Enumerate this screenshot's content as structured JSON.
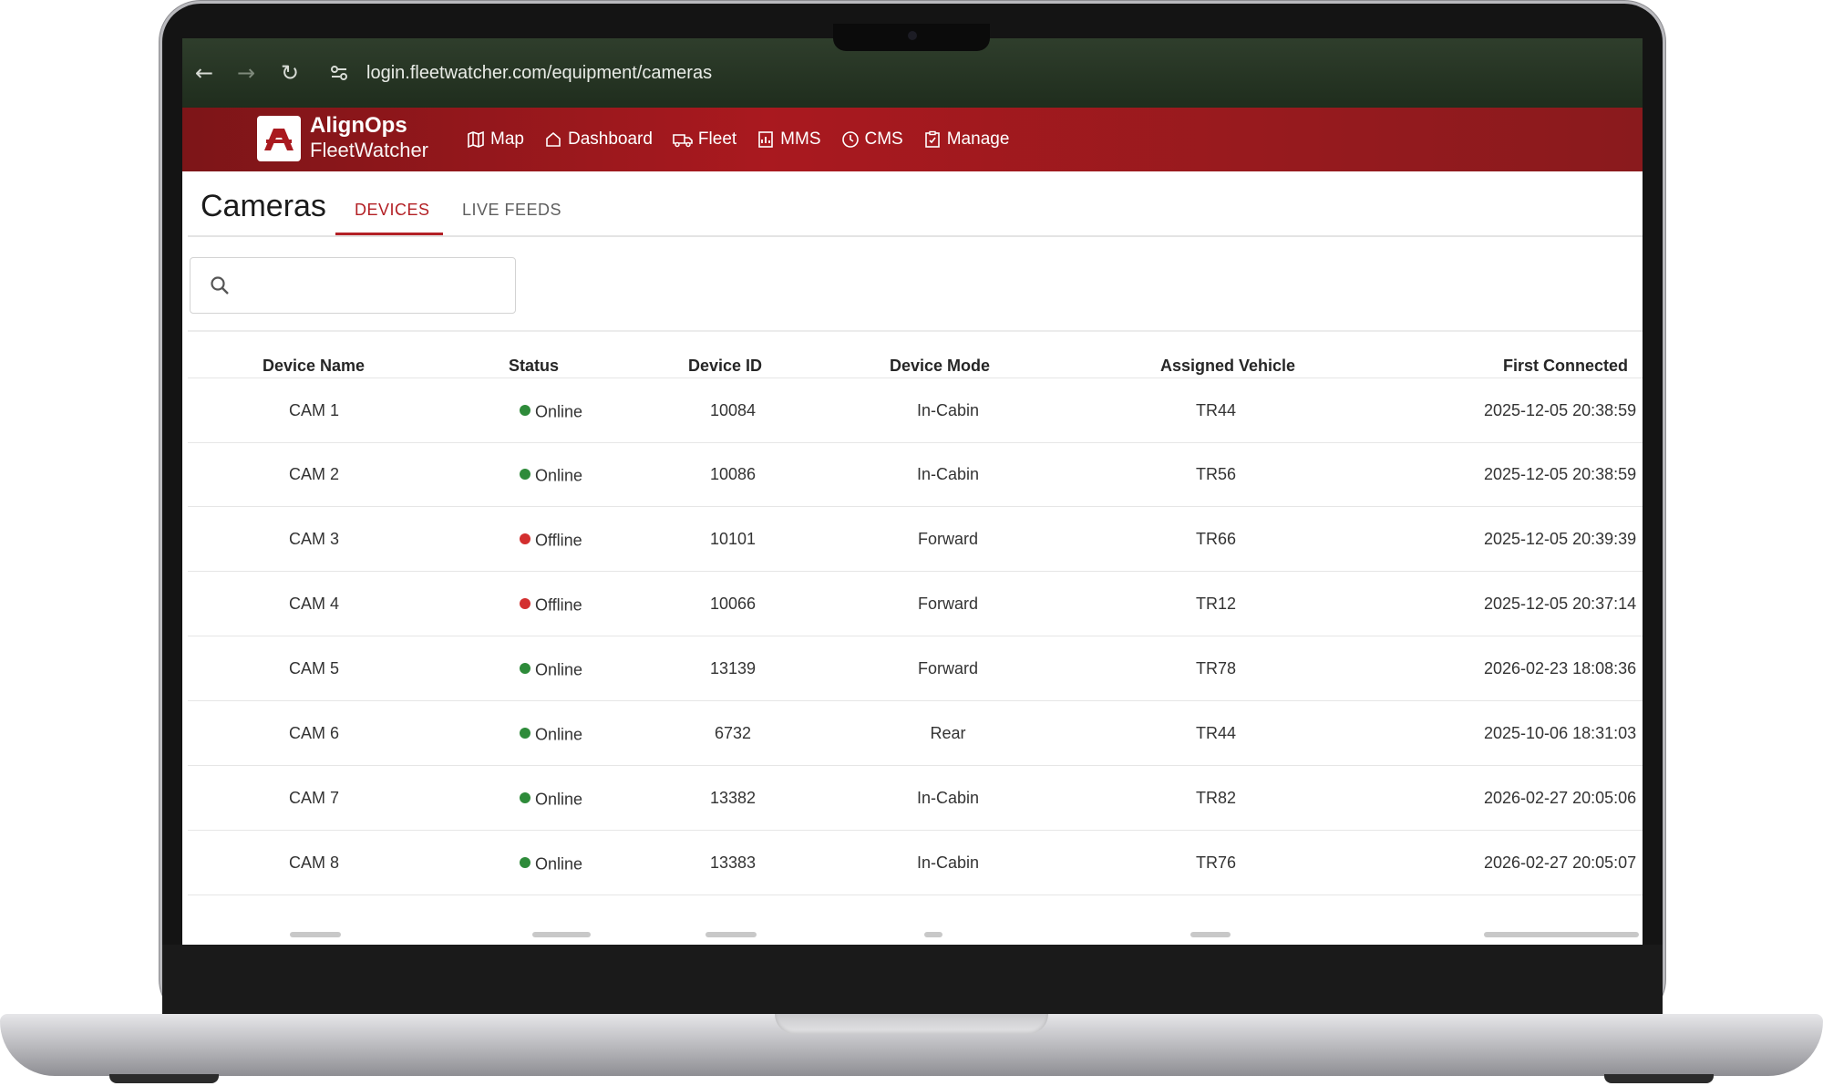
{
  "browser": {
    "back_icon": "arrow-left-icon",
    "forward_icon": "arrow-right-icon",
    "reload_icon": "reload-icon",
    "url": "login.fleetwatcher.com/equipment/cameras"
  },
  "brand": {
    "name_top": "AlignOps",
    "name_bottom": "FleetWatcher"
  },
  "nav": [
    {
      "label": "Map",
      "icon": "map-icon"
    },
    {
      "label": "Dashboard",
      "icon": "home-icon"
    },
    {
      "label": "Fleet",
      "icon": "truck-icon"
    },
    {
      "label": "MMS",
      "icon": "chart-icon"
    },
    {
      "label": "CMS",
      "icon": "clock-icon"
    },
    {
      "label": "Manage",
      "icon": "clipboard-icon"
    }
  ],
  "page": {
    "title": "Cameras",
    "tabs": [
      {
        "label": "DEVICES",
        "active": true
      },
      {
        "label": "LIVE FEEDS",
        "active": false
      }
    ]
  },
  "search": {
    "placeholder": ""
  },
  "table": {
    "headers": [
      "Device Name",
      "Status",
      "Device ID",
      "Device Mode",
      "Assigned Vehicle",
      "First Connected"
    ],
    "rows": [
      {
        "name": "CAM 1",
        "status": "Online",
        "id": "10084",
        "mode": "In-Cabin",
        "vehicle": "TR44",
        "first": "2025-12-05 20:38:59"
      },
      {
        "name": "CAM 2",
        "status": "Online",
        "id": "10086",
        "mode": "In-Cabin",
        "vehicle": "TR56",
        "first": "2025-12-05 20:38:59"
      },
      {
        "name": "CAM 3",
        "status": "Offline",
        "id": "10101",
        "mode": "Forward",
        "vehicle": "TR66",
        "first": "2025-12-05 20:39:39"
      },
      {
        "name": "CAM 4",
        "status": "Offline",
        "id": "10066",
        "mode": "Forward",
        "vehicle": "TR12",
        "first": "2025-12-05 20:37:14"
      },
      {
        "name": "CAM 5",
        "status": "Online",
        "id": "13139",
        "mode": "Forward",
        "vehicle": "TR78",
        "first": "2026-02-23 18:08:36"
      },
      {
        "name": "CAM 6",
        "status": "Online",
        "id": "6732",
        "mode": "Rear",
        "vehicle": "TR44",
        "first": "2025-10-06 18:31:03"
      },
      {
        "name": "CAM 7",
        "status": "Online",
        "id": "13382",
        "mode": "In-Cabin",
        "vehicle": "TR82",
        "first": "2026-02-27 20:05:06"
      },
      {
        "name": "CAM 8",
        "status": "Online",
        "id": "13383",
        "mode": "In-Cabin",
        "vehicle": "TR76",
        "first": "2026-02-27 20:05:07"
      }
    ]
  },
  "colors": {
    "brand_red": "#a9191f",
    "online": "#2e8b3a",
    "offline": "#d32f2f",
    "active_tab": "#b32025"
  }
}
